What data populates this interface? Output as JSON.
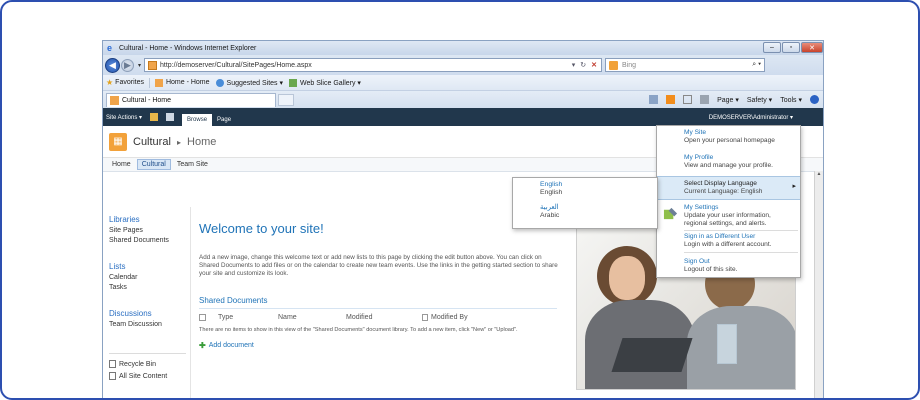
{
  "browser": {
    "window_title": "Cultural - Home - Windows Internet Explorer",
    "address": "http://demoserver/Cultural/SitePages/Home.aspx",
    "search_placeholder": "Bing",
    "favorites_label": "Favorites",
    "favorites": [
      "Home - Home",
      "Suggested Sites ▾",
      "Web Slice Gallery ▾"
    ],
    "tab_title": "Cultural - Home",
    "commands": [
      "Page ▾",
      "Safety ▾",
      "Tools ▾"
    ]
  },
  "ribbon": {
    "site_actions": "Site Actions ▾",
    "tabs": [
      "Browse",
      "Page"
    ],
    "user": "DEMOSERVER\\Administrator ▾"
  },
  "site": {
    "title": "Cultural",
    "crumb": "Home",
    "topnav": [
      "Home",
      "Cultural",
      "Team Site"
    ]
  },
  "quicklaunch": {
    "libraries_head": "Libraries",
    "libraries": [
      "Site Pages",
      "Shared Documents"
    ],
    "lists_head": "Lists",
    "lists": [
      "Calendar",
      "Tasks"
    ],
    "discussions_head": "Discussions",
    "discussions": [
      "Team Discussion"
    ],
    "recycle_bin": "Recycle Bin",
    "all_content": "All Site Content"
  },
  "main": {
    "welcome": "Welcome to your site!",
    "paragraph": "Add a new image, change this welcome text or add new lists to this page by clicking the edit button above. You can click on Shared Documents to add files or on the calendar to create new team events. Use the links in the getting started section to share your site and customize its look.",
    "shared_docs_title": "Shared Documents",
    "columns": [
      "Type",
      "Name",
      "Modified",
      "Modified By"
    ],
    "no_items": "There are no items to show in this view of the \"Shared Documents\" document library. To add a new item, click \"New\" or \"Upload\".",
    "add_document": "Add document"
  },
  "user_menu": {
    "items": [
      {
        "title": "My Site",
        "desc": "Open your personal homepage"
      },
      {
        "title": "My Profile",
        "desc": "View and manage your profile."
      },
      {
        "title": "Select Display Language",
        "desc": "Current Language: English"
      },
      {
        "title": "My Settings",
        "desc": "Update your user information, regional settings, and alerts."
      },
      {
        "title": "Sign in as Different User",
        "desc": "Login with a different account."
      },
      {
        "title": "Sign Out",
        "desc": "Logout of this site."
      }
    ]
  },
  "language_menu": {
    "items": [
      {
        "title": "English",
        "desc": "English"
      },
      {
        "title": "العربية",
        "desc": "Arabic"
      }
    ]
  },
  "colors": {
    "ribbon_bg": "#21374c",
    "link_blue": "#1f73b7",
    "frame_border": "#2d4fb0",
    "site_logo": "#f2a13a"
  },
  "icons": [
    "ie-logo",
    "back-icon",
    "forward-icon",
    "refresh-icon",
    "stop-icon",
    "search-icon",
    "favorites-star-icon",
    "home-icon",
    "rss-icon",
    "mail-icon",
    "print-icon",
    "help-icon",
    "settings-icon",
    "recycle-bin-icon",
    "all-content-icon",
    "add-icon"
  ]
}
